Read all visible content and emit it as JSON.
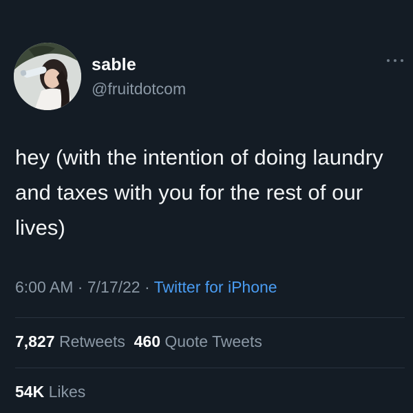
{
  "colors": {
    "background": "#141c25",
    "text_primary": "#ffffff",
    "text_secondary": "#8b98a5",
    "link": "#4a9cf2",
    "divider": "#2a3440"
  },
  "author": {
    "name": "sable",
    "handle": "@fruitdotcom",
    "avatar_icon": "avatar-photo"
  },
  "tweet": {
    "text": "hey (with the intention of doing laundry and taxes with you for the rest of our lives)"
  },
  "meta": {
    "time": "6:00 AM",
    "separator1": " · ",
    "date": "7/17/22",
    "separator2": " · ",
    "client": "Twitter for iPhone"
  },
  "stats": {
    "retweets_count": "7,827",
    "retweets_label": "Retweets",
    "quotes_count": "460",
    "quotes_label": "Quote Tweets",
    "likes_count": "54K",
    "likes_label": "Likes"
  },
  "more_icon": "more-horizontal-icon"
}
